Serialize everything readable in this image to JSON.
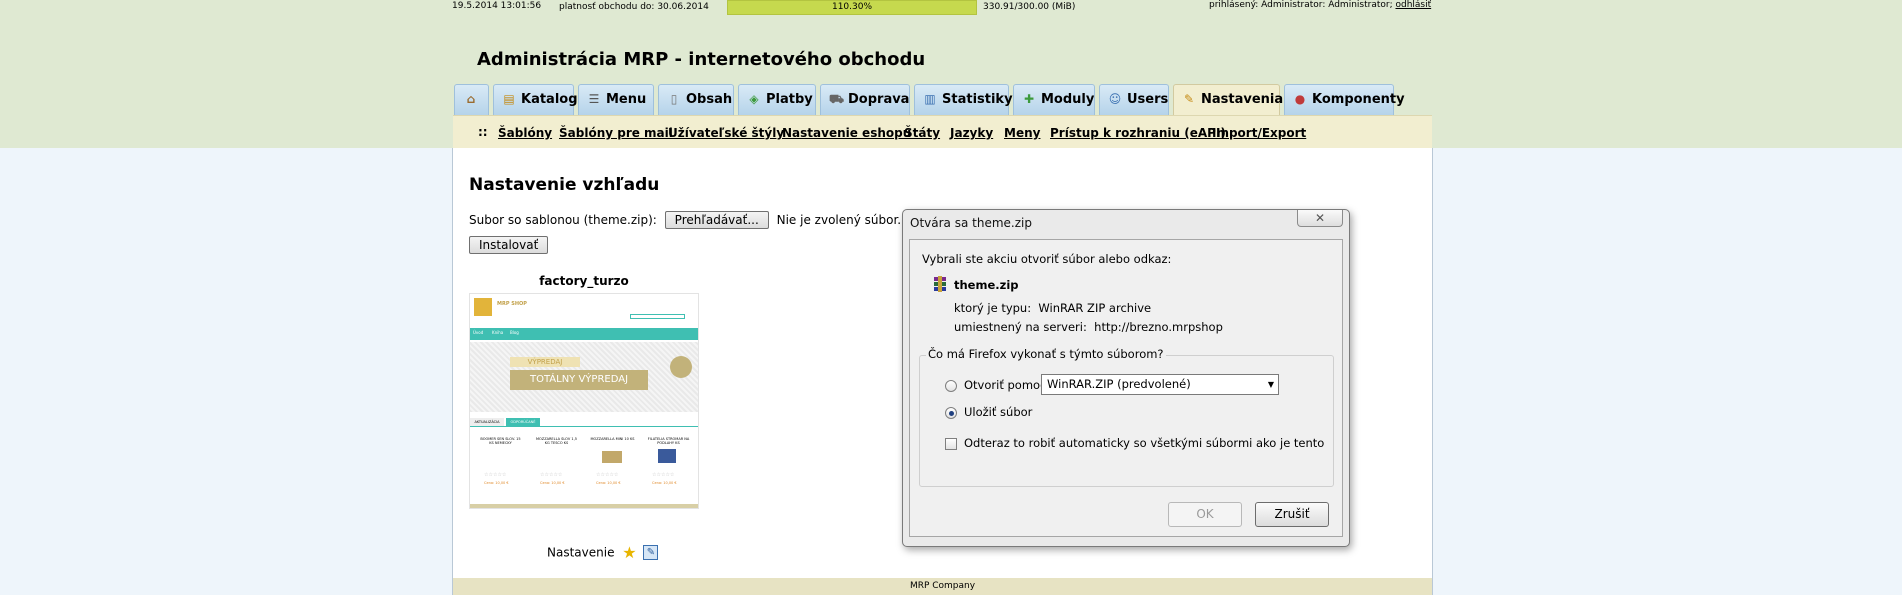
{
  "status": {
    "datetime": "19.5.2014 13:01:56",
    "validity": "platnosť obchodu do: 30.06.2014",
    "quota_percent_label": "110.30%",
    "quota_fraction": 1.0,
    "quota_size": "330.91/300.00 (MiB)",
    "login_prefix": "prihlásený: Administrator: Administrator;",
    "logout_label": "odhlásiť"
  },
  "site": {
    "title": "Administrácia MRP - internetového obchodu"
  },
  "tabs": [
    {
      "label": "",
      "icon": "home-icon"
    },
    {
      "label": "Katalog",
      "icon": "catalog-icon"
    },
    {
      "label": "Menu",
      "icon": "menu-icon"
    },
    {
      "label": "Obsah",
      "icon": "page-icon"
    },
    {
      "label": "Platby",
      "icon": "money-icon"
    },
    {
      "label": "Doprava",
      "icon": "truck-icon"
    },
    {
      "label": "Statistiky",
      "icon": "chart-icon"
    },
    {
      "label": "Moduly",
      "icon": "puzzle-icon"
    },
    {
      "label": "Users",
      "icon": "user-icon"
    },
    {
      "label": "Nastavenia",
      "icon": "settings-icon",
      "active": true
    },
    {
      "label": "Komponenty",
      "icon": "components-icon"
    }
  ],
  "subnav": {
    "separator": "::",
    "items": [
      "Šablóny",
      "Šablóny pre mail",
      "Užívateľské štýly",
      "Nastavenie eshopu",
      "Štáty",
      "Jazyky",
      "Meny",
      "Prístup k rozhraniu (eAPI)",
      "Import/Export"
    ]
  },
  "page": {
    "heading": "Nastavenie vzhľadu",
    "file_label": "Subor so sablonou (theme.zip):",
    "browse_label": "Prehľadávať...",
    "no_file_label": "Nie je zvolený súbor.",
    "install_label": "Instalovať",
    "theme_name": "factory_turzo",
    "settings_label": "Nastavenie"
  },
  "thumbnail": {
    "shop_title": "MRP SHOP",
    "nav": [
      "Úvod",
      "Kniha",
      "Blog"
    ],
    "banner_1": "VÝPREDAJ",
    "banner_2": "TOTÁLNY VÝPREDAJ",
    "tabs": [
      "AKTUALIZÁCIA",
      "ODPORÚČANÉ"
    ],
    "products": [
      "BOOMER SEN SLOV. 15 KS NEMECKY",
      "MOZZARELLA SLOV 1,5 KG TESCO KS",
      "MOZZARELLA MINI 10 KS",
      "FILATELIA STROMAR NA PODLAHY KS"
    ],
    "price": "Cena: 10,00 €"
  },
  "dialog": {
    "title": "Otvára sa theme.zip",
    "close_glyph": "✕",
    "question": "Vybrali ste akciu otvoriť súbor alebo odkaz:",
    "file_name": "theme.zip",
    "type_label": "ktorý je typu:",
    "type_value": "WinRAR ZIP archive",
    "server_label": "umiestnený na serveri:",
    "server_value": "http://brezno.mrpshop",
    "action_question": "Čo má Firefox vykonať s týmto súborom?",
    "open_with_label": "Otvoriť pomocou",
    "open_with_value": "WinRAR.ZIP (predvolené)",
    "save_label": "Uložiť súbor",
    "auto_label": "Odteraz to robiť automaticky so všetkými súbormi ako je tento",
    "ok_label": "OK",
    "cancel_label": "Zrušiť"
  },
  "footer": {
    "text": "MRP Company"
  },
  "colors": {
    "top_band": "#dfe9d2",
    "tab": "#c4dcee",
    "active_tab": "#f2eed0",
    "quota_bar": "#c6d94e",
    "thumb_teal": "#3fbfb2",
    "thumb_gold": "#c2b27a"
  }
}
